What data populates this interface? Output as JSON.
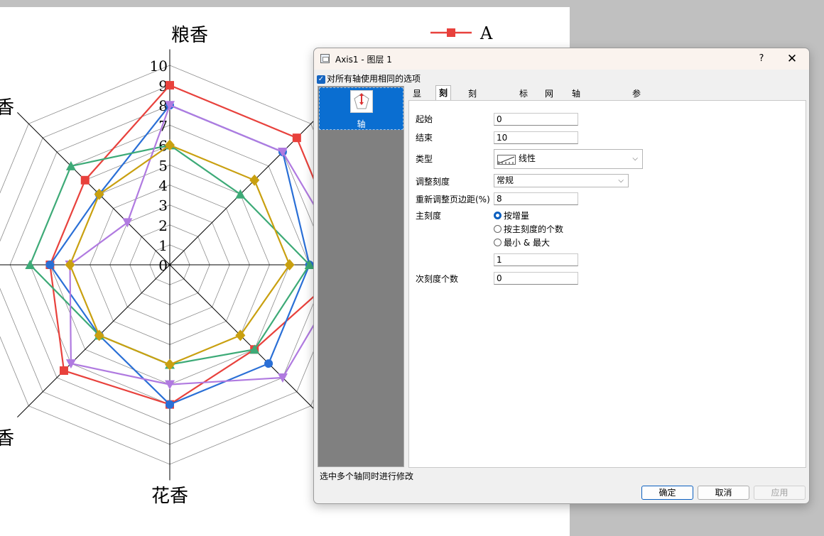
{
  "chart_data": {
    "type": "radar",
    "axes": [
      {
        "label": "粮香",
        "visible_label": "粮香"
      },
      {
        "label": "",
        "visible_label": ""
      },
      {
        "label": "",
        "visible_label": ""
      },
      {
        "label": "",
        "visible_label": ""
      },
      {
        "label": "花香",
        "visible_label": "花香"
      },
      {
        "label": "香",
        "visible_label": "香"
      },
      {
        "label": "",
        "visible_label": ""
      },
      {
        "label": "香",
        "visible_label": "香"
      }
    ],
    "rlim": [
      0,
      10
    ],
    "ticks": [
      "0",
      "1",
      "2",
      "3",
      "4",
      "5",
      "6",
      "7",
      "8",
      "9",
      "10"
    ],
    "legend": [
      {
        "name": "A",
        "color": "#e8413c"
      }
    ],
    "series": [
      {
        "name": "A",
        "color": "#e8413c",
        "marker": "square",
        "values": [
          9,
          9,
          9,
          6,
          7,
          7.5,
          6,
          6
        ]
      },
      {
        "name": "",
        "color": "#2a6fd6",
        "marker": "circle",
        "values": [
          8,
          8,
          7,
          7,
          7,
          5,
          6,
          5
        ]
      },
      {
        "name": "",
        "color": "#3daa77",
        "marker": "triangle-up",
        "values": [
          6,
          5,
          7,
          6,
          5,
          5,
          7,
          7
        ]
      },
      {
        "name": "",
        "color": "#b07ae0",
        "marker": "triangle-down",
        "values": [
          8,
          8,
          9,
          8,
          6,
          7,
          5,
          3
        ]
      },
      {
        "name": "",
        "color": "#c9a010",
        "marker": "diamond",
        "values": [
          6,
          6,
          6,
          5,
          5,
          5,
          5,
          5
        ]
      }
    ]
  },
  "dialog": {
    "title": "Axis1 - 图层 1",
    "help_label": "?",
    "close_label": "✕",
    "same_options_label": "对所有轴使用相同的选项",
    "side_item_label": "轴",
    "tabs": [
      "显示",
      "刻度",
      "刻度线标签",
      "标题",
      "网格",
      "轴线和刻度线",
      "参照线"
    ],
    "active_tab": "刻度",
    "form": {
      "start_label": "起始",
      "start_value": "0",
      "end_label": "结束",
      "end_value": "10",
      "type_label": "类型",
      "type_value": "线性",
      "rescale_label": "调整刻度",
      "rescale_value": "常规",
      "margin_label": "重新调整页边距(%)",
      "margin_value": "8",
      "major_label": "主刻度",
      "major_options": [
        "按增量",
        "按主刻度的个数",
        "最小 & 最大"
      ],
      "major_selected": "按增量",
      "major_value": "1",
      "minor_label": "次刻度个数",
      "minor_value": "0"
    },
    "status_text": "选中多个轴同时进行修改",
    "buttons": {
      "ok": "确定",
      "cancel": "取消",
      "apply": "应用"
    }
  }
}
